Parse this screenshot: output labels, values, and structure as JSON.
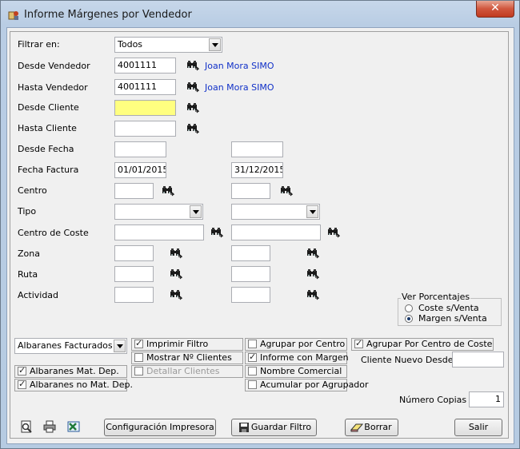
{
  "window": {
    "title": "Informe Márgenes por Vendedor",
    "close_glyph": "✕"
  },
  "filter": {
    "label": "Filtrar en:",
    "value": "Todos"
  },
  "desde_vendedor": {
    "label": "Desde Vendedor",
    "value": "4001111",
    "name": "Joan Mora SIMO"
  },
  "hasta_vendedor": {
    "label": "Hasta Vendedor",
    "value": "4001111",
    "name": "Joan Mora SIMO"
  },
  "desde_cliente": {
    "label": "Desde Cliente",
    "value": ""
  },
  "hasta_cliente": {
    "label": "Hasta Cliente",
    "value": ""
  },
  "desde_fecha": {
    "label": "Desde Fecha",
    "from": "",
    "to": ""
  },
  "fecha_factura": {
    "label": "Fecha Factura",
    "from": "01/01/2015",
    "to": "31/12/2015"
  },
  "centro": {
    "label": "Centro"
  },
  "tipo": {
    "label": "Tipo"
  },
  "centro_coste": {
    "label": "Centro de Coste"
  },
  "zona": {
    "label": "Zona"
  },
  "ruta": {
    "label": "Ruta"
  },
  "actividad": {
    "label": "Actividad"
  },
  "ver_porcentajes": {
    "legend": "Ver Porcentajes",
    "option1": "Coste s/Venta",
    "option2": "Margen s/Venta",
    "selected": "Margen s/Venta"
  },
  "options": {
    "albaranes_select": "Albaranes Facturados",
    "imprimir_filtro": "Imprimir Filtro",
    "mostrar_clientes": "Mostrar Nº Clientes",
    "detallar_clientes": "Detallar Clientes",
    "mat_dep": "Albaranes Mat. Dep.",
    "no_mat_dep": "Albaranes no Mat. Dep.",
    "agrupar_centro": "Agrupar por Centro",
    "informe_margen": "Informe con Margen",
    "nombre_comercial": "Nombre Comercial",
    "acumular": "Acumular por Agrupador",
    "agrupar_coste": "Agrupar Por Centro de Coste",
    "cliente_nuevo": "Cliente Nuevo Desde",
    "copias_label": "Número Copias",
    "copias_value": "1"
  },
  "buttons": {
    "config": "Configuración Impresora",
    "guardar": "Guardar Filtro",
    "borrar": "Borrar",
    "salir": "Salir"
  }
}
